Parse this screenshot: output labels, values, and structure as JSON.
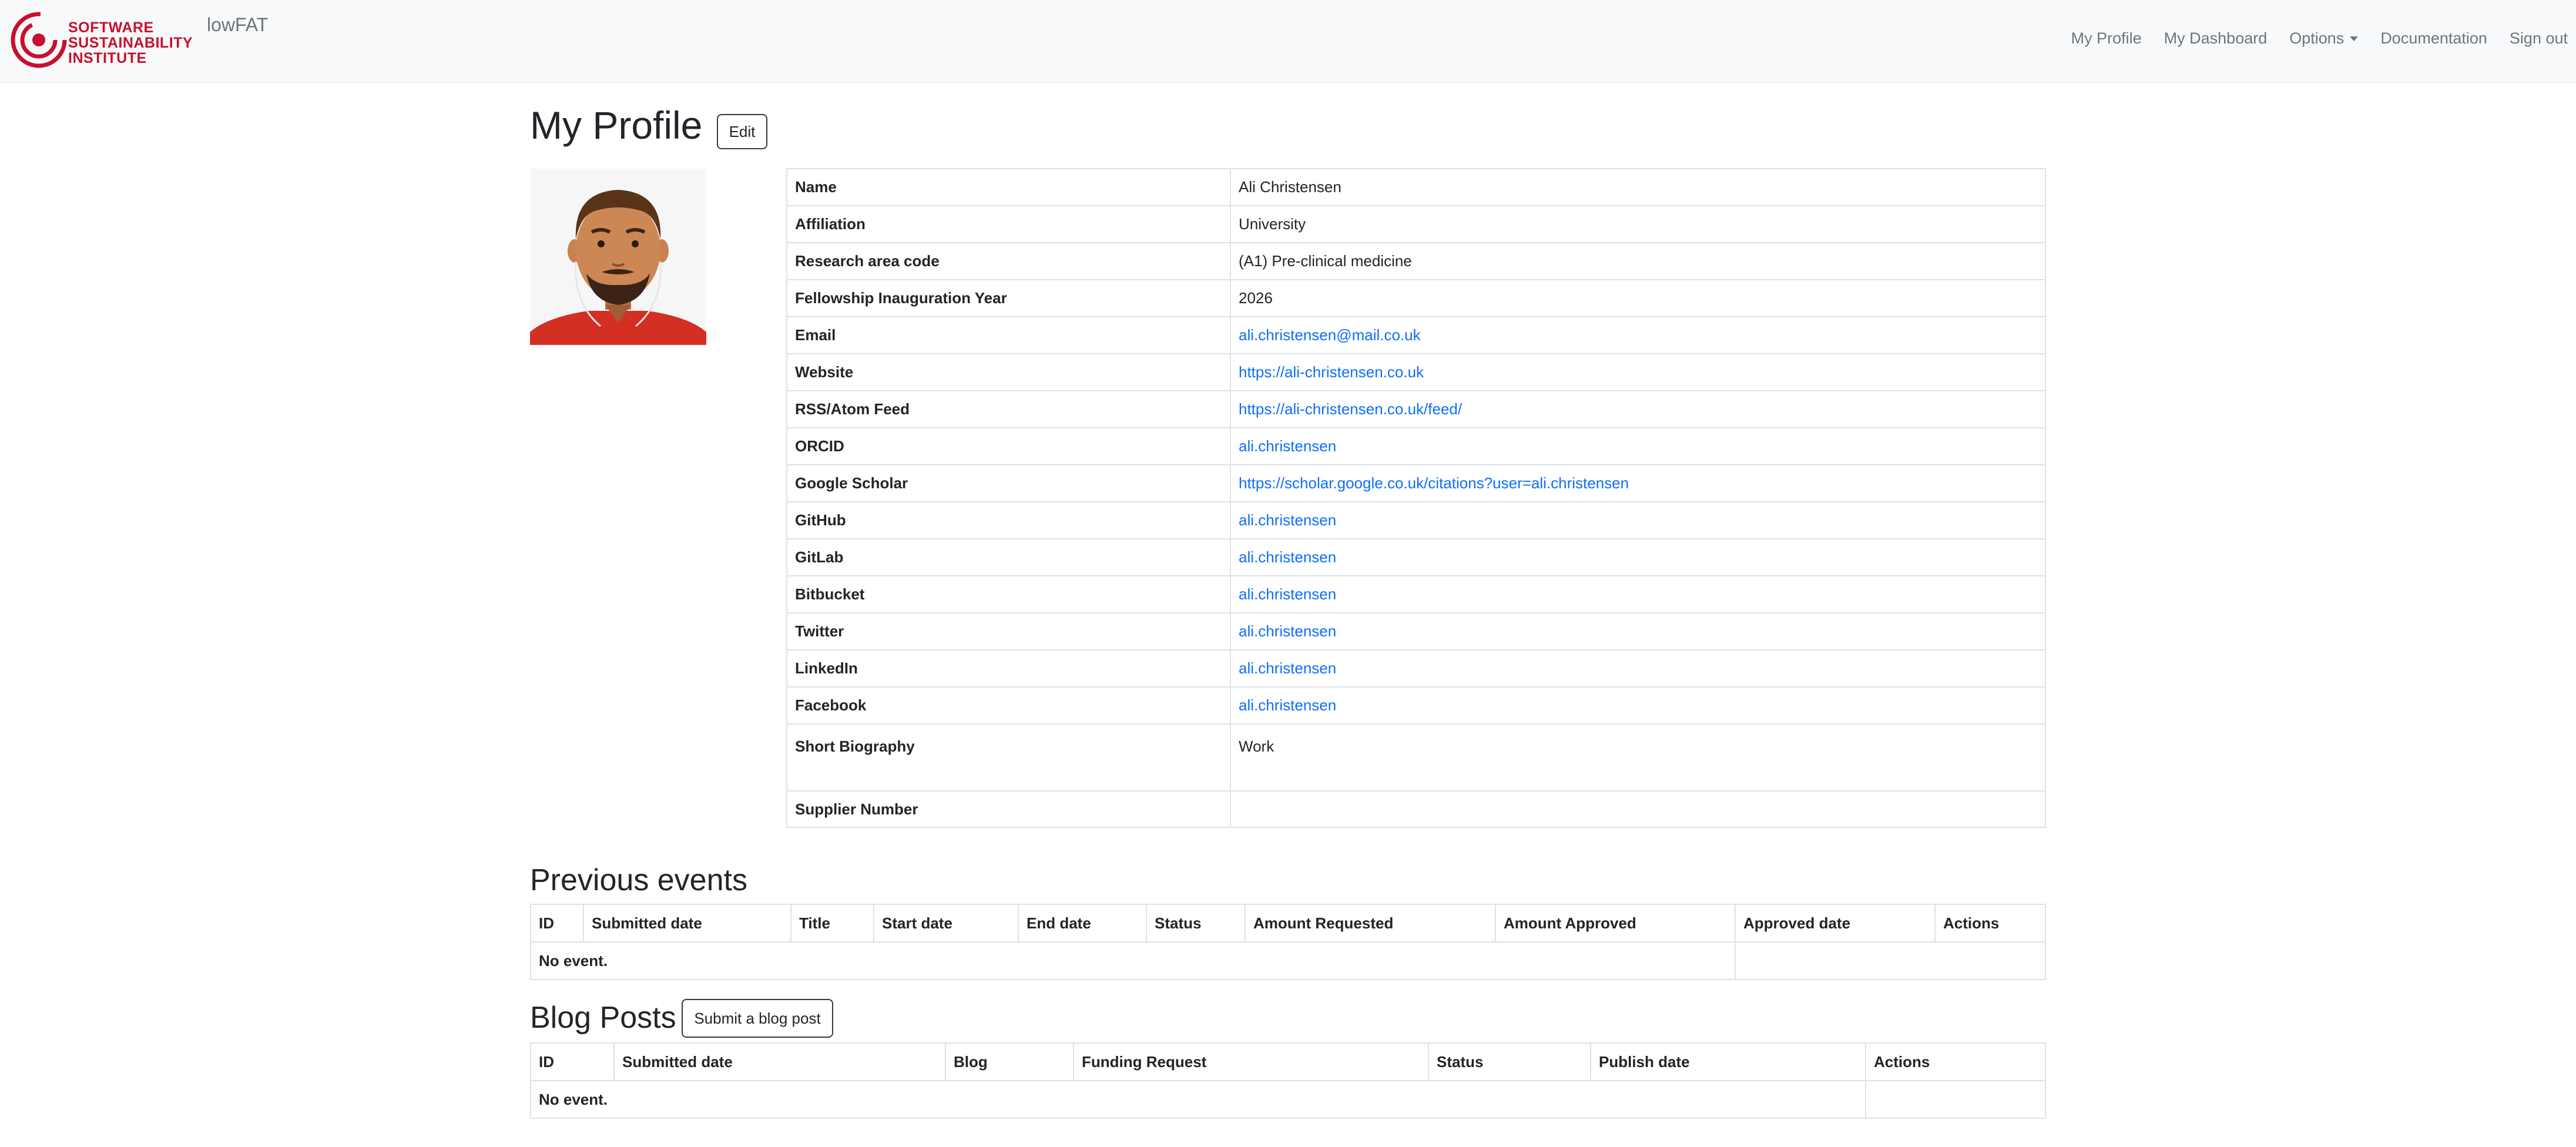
{
  "navbar": {
    "logo_lines": [
      "SOFTWARE",
      "SUSTAINABILITY",
      "INSTITUTE"
    ],
    "brand": "lowFAT",
    "links": {
      "my_profile": "My Profile",
      "my_dashboard": "My Dashboard",
      "options": "Options",
      "documentation": "Documentation",
      "sign_out": "Sign out"
    }
  },
  "profile": {
    "title": "My Profile",
    "edit_label": "Edit",
    "fields": {
      "name": {
        "label": "Name",
        "value": "Ali Christensen"
      },
      "affiliation": {
        "label": "Affiliation",
        "value": "University"
      },
      "research_area": {
        "label": "Research area code",
        "value": "(A1) Pre-clinical medicine"
      },
      "inauguration_year": {
        "label": "Fellowship Inauguration Year",
        "value": "2026"
      },
      "email": {
        "label": "Email",
        "value": "ali.christensen@mail.co.uk"
      },
      "website": {
        "label": "Website",
        "value": "https://ali-christensen.co.uk"
      },
      "rss": {
        "label": "RSS/Atom Feed",
        "value": "https://ali-christensen.co.uk/feed/"
      },
      "orcid": {
        "label": "ORCID",
        "value": "ali.christensen"
      },
      "google_scholar": {
        "label": "Google Scholar",
        "value": "https://scholar.google.co.uk/citations?user=ali.christensen"
      },
      "github": {
        "label": "GitHub",
        "value": "ali.christensen"
      },
      "gitlab": {
        "label": "GitLab",
        "value": "ali.christensen"
      },
      "bitbucket": {
        "label": "Bitbucket",
        "value": "ali.christensen"
      },
      "twitter": {
        "label": "Twitter",
        "value": "ali.christensen"
      },
      "linkedin": {
        "label": "LinkedIn",
        "value": "ali.christensen"
      },
      "facebook": {
        "label": "Facebook",
        "value": "ali.christensen"
      },
      "bio": {
        "label": "Short Biography",
        "value": "Work"
      },
      "supplier": {
        "label": "Supplier Number",
        "value": ""
      }
    }
  },
  "previous_events": {
    "title": "Previous events",
    "columns": [
      "ID",
      "Submitted date",
      "Title",
      "Start date",
      "End date",
      "Status",
      "Amount Requested",
      "Amount Approved",
      "Approved date",
      "Actions"
    ],
    "empty_text": "No event."
  },
  "blog_posts": {
    "title": "Blog Posts",
    "submit_label": "Submit a blog post",
    "columns": [
      "ID",
      "Submitted date",
      "Blog",
      "Funding Request",
      "Status",
      "Publish date",
      "Actions"
    ],
    "empty_text": "No event."
  },
  "colors": {
    "link": "#0d6efd",
    "brand_red": "#c8102e",
    "navbar_bg": "#f8f9fa"
  }
}
